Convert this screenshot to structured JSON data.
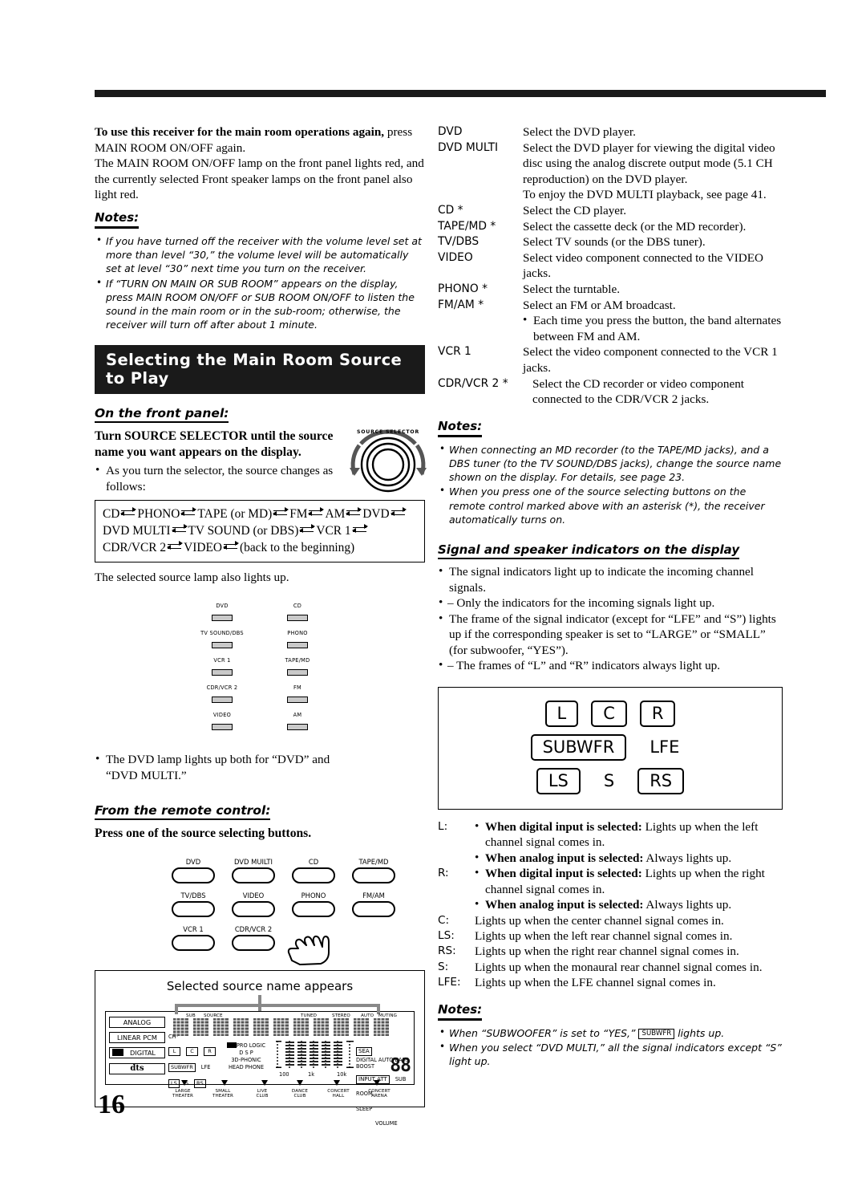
{
  "page_number": "16",
  "left_column": {
    "intro": {
      "lead_bold": "To use this receiver for the main room operations again,",
      "lead_rest": " press MAIN ROOM ON/OFF again.",
      "body": "The MAIN ROOM ON/OFF lamp on the front panel lights red, and the currently selected Front speaker lamps on the front panel also light red."
    },
    "notes_heading": "Notes:",
    "notes": [
      "If you have turned off the receiver with the volume level set at more than level “30,” the volume level will be automatically set at level “30” next time you turn on the receiver.",
      "If “TURN ON MAIN OR SUB ROOM” appears on the display, press MAIN ROOM ON/OFF or SUB ROOM ON/OFF to listen the sound in the main room or in the sub-room; otherwise, the receiver will turn off after about 1 minute."
    ],
    "banner_title": "Selecting the Main Room Source to Play",
    "front_panel": {
      "heading": "On the front panel:",
      "instruction": "Turn SOURCE SELECTOR until the source name you want appears on the display.",
      "bullet": "As you turn the selector, the source changes as follows:",
      "knob_label": "SOURCE SELECTOR",
      "cycle_lines": [
        [
          "CD",
          "PHONO",
          "TAPE (or MD)",
          "FM",
          "AM",
          "DVD"
        ],
        [
          "DVD MULTI",
          "TV SOUND (or DBS)",
          "VCR 1"
        ],
        [
          "CDR/VCR 2",
          "VIDEO",
          "(back to the beginning)"
        ]
      ],
      "after_box": "The selected source lamp also lights up.",
      "lamps": [
        [
          "DVD",
          "CD"
        ],
        [
          "TV SOUND/DBS",
          "PHONO"
        ],
        [
          "VCR 1",
          "TAPE/MD"
        ],
        [
          "CDR/VCR 2",
          "FM"
        ],
        [
          "VIDEO",
          "AM"
        ]
      ],
      "lamp_note": "The DVD lamp lights up both for “DVD” and “DVD MULTI.”"
    },
    "remote": {
      "heading": "From the remote control:",
      "instruction": "Press one of the source selecting buttons.",
      "buttons": [
        [
          "DVD",
          "DVD MUILTI",
          "CD",
          "TAPE/MD"
        ],
        [
          "TV/DBS",
          "VIDEO",
          "PHONO",
          "FM/AM"
        ],
        [
          "VCR 1",
          "CDR/VCR 2"
        ]
      ]
    },
    "display_figure": {
      "caption": "Selected source name appears",
      "left_badges": [
        "ANALOG",
        "LINEAR PCM",
        "DIGITAL",
        "dts"
      ],
      "ch_label": "CH-",
      "speaker_row1": [
        "L",
        "C",
        "R"
      ],
      "speaker_row2": [
        "SUBWFR",
        "LFE"
      ],
      "speaker_row3": [
        "LS",
        "S",
        "RS"
      ],
      "mode_labels": [
        "PRO LOGIC",
        "D  S  P",
        "3D-PHONIC",
        "HEAD PHONE"
      ],
      "top_labels": [
        "SUB",
        "SOURCE",
        "TUNED",
        "STEREO",
        "AUTO",
        "MUTING"
      ],
      "eq_ticks": [
        "100",
        "1k",
        "10k"
      ],
      "right_labels": [
        "SEA",
        "DIGITAL AUTO BASS BOOST",
        "INPUT ATT",
        "SUB ROOM",
        "SLEEP",
        "VOLUME"
      ],
      "volume_value": "88",
      "dsp_modes": [
        "LARGE\nTHEATER",
        "SMALL\nTHEATER",
        "LIVE\nCLUB",
        "DANCE\nCLUB",
        "CONCERT\nHALL",
        "CONCERT\nARENA"
      ]
    }
  },
  "right_column": {
    "sources": [
      {
        "name": "DVD",
        "lines": [
          "Select the DVD player."
        ]
      },
      {
        "name": "DVD MULTI",
        "lines": [
          "Select the DVD player for viewing the digital video disc using the analog discrete output mode (5.1 CH reproduction) on the DVD player.",
          "To enjoy the DVD MULTI playback, see page 41."
        ]
      },
      {
        "name": "CD *",
        "lines": [
          "Select the CD player."
        ]
      },
      {
        "name": "TAPE/MD *",
        "lines": [
          "Select the cassette deck (or the MD recorder)."
        ]
      },
      {
        "name": "TV/DBS",
        "lines": [
          "Select TV sounds (or the DBS tuner)."
        ]
      },
      {
        "name": "VIDEO",
        "lines": [
          "Select video component connected to the VIDEO jacks."
        ]
      },
      {
        "name": "PHONO *",
        "lines": [
          "Select the turntable."
        ]
      },
      {
        "name": "FM/AM *",
        "lines": [
          "Select an FM or AM broadcast."
        ],
        "bullets": [
          "Each time you press the button, the band alternates between FM and AM."
        ]
      },
      {
        "name": "VCR 1",
        "lines": [
          "Select the video component connected to the VCR 1 jacks."
        ]
      },
      {
        "name": "CDR/VCR 2 *",
        "lines": [
          "Select the CD recorder or video component connected to the CDR/VCR 2 jacks."
        ]
      }
    ],
    "notes_heading": "Notes:",
    "notes": [
      "When connecting an MD recorder (to the TAPE/MD jacks), and a DBS tuner (to the TV SOUND/DBS jacks), change the source name shown on the display. For details, see page 23.",
      "When you press one of the source selecting buttons on the remote control marked above with an asterisk (*), the receiver automatically turns on."
    ],
    "indicators_heading": "Signal and speaker indicators on the display",
    "indicator_bullets": [
      "The signal indicators light up to indicate the incoming channel signals.",
      "The frame of the signal indicator (except for “LFE” and “S”) lights up if the corresponding speaker is set to “LARGE” or “SMALL” (for subwoofer, “YES”)."
    ],
    "indicator_subbullets": [
      "– Only the indicators for the incoming signals light up.",
      "– The frames of “L” and “R” indicators always light up."
    ],
    "indicator_figure": {
      "row1": [
        "L",
        "C",
        "R"
      ],
      "row2": [
        "SUBWFR",
        "LFE"
      ],
      "row3": [
        "LS",
        "S",
        "RS"
      ]
    },
    "definitions": [
      {
        "key": "L:",
        "bullets": [
          {
            "bold": "When digital input is selected:",
            "rest": " Lights up when the left channel signal comes in."
          },
          {
            "bold": "When analog input is selected:",
            "rest": " Always lights up."
          }
        ]
      },
      {
        "key": "R:",
        "bullets": [
          {
            "bold": "When digital input is selected:",
            "rest": " Lights up when the right channel signal comes in."
          },
          {
            "bold": "When analog input is selected:",
            "rest": " Always lights up."
          }
        ]
      },
      {
        "key": "C:",
        "plain": "Lights up when the center channel signal comes in."
      },
      {
        "key": "LS:",
        "plain": "Lights up when the left rear channel signal comes in."
      },
      {
        "key": "RS:",
        "plain": "Lights up when the right rear channel signal comes in."
      },
      {
        "key": "S:",
        "plain": "Lights up when the monaural rear channel signal comes in."
      },
      {
        "key": "LFE:",
        "plain": "Lights up when the LFE channel signal comes in."
      }
    ],
    "bottom_notes_heading": "Notes:",
    "bottom_notes": [
      {
        "pre": "When “SUBWOOFER” is set to “YES,” ",
        "chip": "SUBWFR",
        "post": " lights up."
      },
      {
        "pre": "When you select “DVD MULTI,” all the signal indicators except “S” light up.",
        "chip": "",
        "post": ""
      }
    ]
  }
}
